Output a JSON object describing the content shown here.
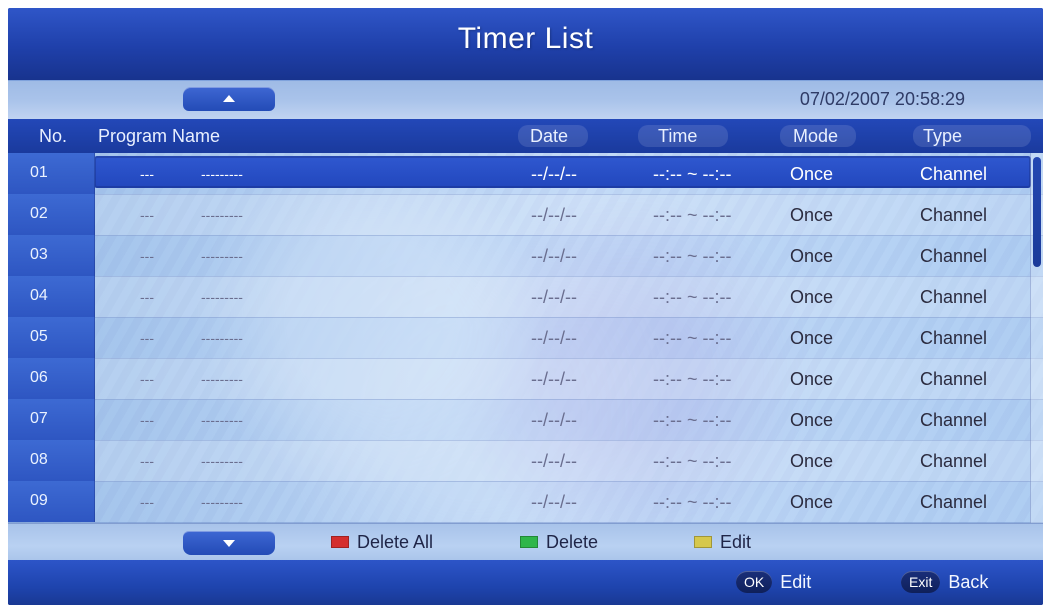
{
  "title": "Timer List",
  "datetime": "07/02/2007 20:58:29",
  "columns": {
    "no": "No.",
    "program_name": "Program Name",
    "date": "Date",
    "time": "Time",
    "mode": "Mode",
    "type": "Type"
  },
  "rows": [
    {
      "no": "01",
      "dash1": "---",
      "dash2": "---------",
      "date": "--/--/--",
      "time": "--:-- ~ --:--",
      "mode": "Once",
      "type": "Channel"
    },
    {
      "no": "02",
      "dash1": "---",
      "dash2": "---------",
      "date": "--/--/--",
      "time": "--:-- ~ --:--",
      "mode": "Once",
      "type": "Channel"
    },
    {
      "no": "03",
      "dash1": "---",
      "dash2": "---------",
      "date": "--/--/--",
      "time": "--:-- ~ --:--",
      "mode": "Once",
      "type": "Channel"
    },
    {
      "no": "04",
      "dash1": "---",
      "dash2": "---------",
      "date": "--/--/--",
      "time": "--:-- ~ --:--",
      "mode": "Once",
      "type": "Channel"
    },
    {
      "no": "05",
      "dash1": "---",
      "dash2": "---------",
      "date": "--/--/--",
      "time": "--:-- ~ --:--",
      "mode": "Once",
      "type": "Channel"
    },
    {
      "no": "06",
      "dash1": "---",
      "dash2": "---------",
      "date": "--/--/--",
      "time": "--:-- ~ --:--",
      "mode": "Once",
      "type": "Channel"
    },
    {
      "no": "07",
      "dash1": "---",
      "dash2": "---------",
      "date": "--/--/--",
      "time": "--:-- ~ --:--",
      "mode": "Once",
      "type": "Channel"
    },
    {
      "no": "08",
      "dash1": "---",
      "dash2": "---------",
      "date": "--/--/--",
      "time": "--:-- ~ --:--",
      "mode": "Once",
      "type": "Channel"
    },
    {
      "no": "09",
      "dash1": "---",
      "dash2": "---------",
      "date": "--/--/--",
      "time": "--:-- ~ --:--",
      "mode": "Once",
      "type": "Channel"
    }
  ],
  "legend": {
    "delete_all": "Delete All",
    "delete": "Delete",
    "edit": "Edit",
    "colors": {
      "red": "#d42d2d",
      "green": "#2fb64a",
      "yellow": "#d6c84d"
    }
  },
  "footer": {
    "ok_key": "OK",
    "ok_label": "Edit",
    "exit_key": "Exit",
    "exit_label": "Back"
  },
  "icons": {
    "scroll_up": "chevron-up-icon",
    "scroll_down": "chevron-down-icon"
  }
}
